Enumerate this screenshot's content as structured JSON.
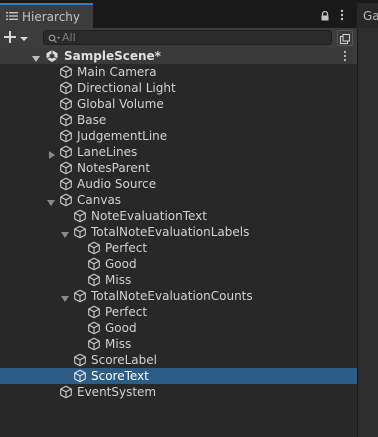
{
  "window": {
    "tab_label": "Hierarchy",
    "game_tab_label": "Ga"
  },
  "toolbar": {
    "add_label": "+",
    "search_placeholder": "All"
  },
  "scene": {
    "name": "SampleScene*"
  },
  "nodes": [
    {
      "label": "Main Camera"
    },
    {
      "label": "Directional Light"
    },
    {
      "label": "Global Volume"
    },
    {
      "label": "Base"
    },
    {
      "label": "JudgementLine"
    },
    {
      "label": "LaneLines"
    },
    {
      "label": "NotesParent"
    },
    {
      "label": "Audio Source"
    },
    {
      "label": "Canvas"
    },
    {
      "label": "NoteEvaluationText"
    },
    {
      "label": "TotalNoteEvaluationLabels"
    },
    {
      "label": "Perfect"
    },
    {
      "label": "Good"
    },
    {
      "label": "Miss"
    },
    {
      "label": "TotalNoteEvaluationCounts"
    },
    {
      "label": "Perfect"
    },
    {
      "label": "Good"
    },
    {
      "label": "Miss"
    },
    {
      "label": "ScoreLabel"
    },
    {
      "label": "ScoreText"
    },
    {
      "label": "EventSystem"
    }
  ],
  "colors": {
    "selection": "#2c5d87",
    "active_tab_accent": "#3a79bb",
    "panel_background": "#282828",
    "text": "#d2d2d2"
  }
}
